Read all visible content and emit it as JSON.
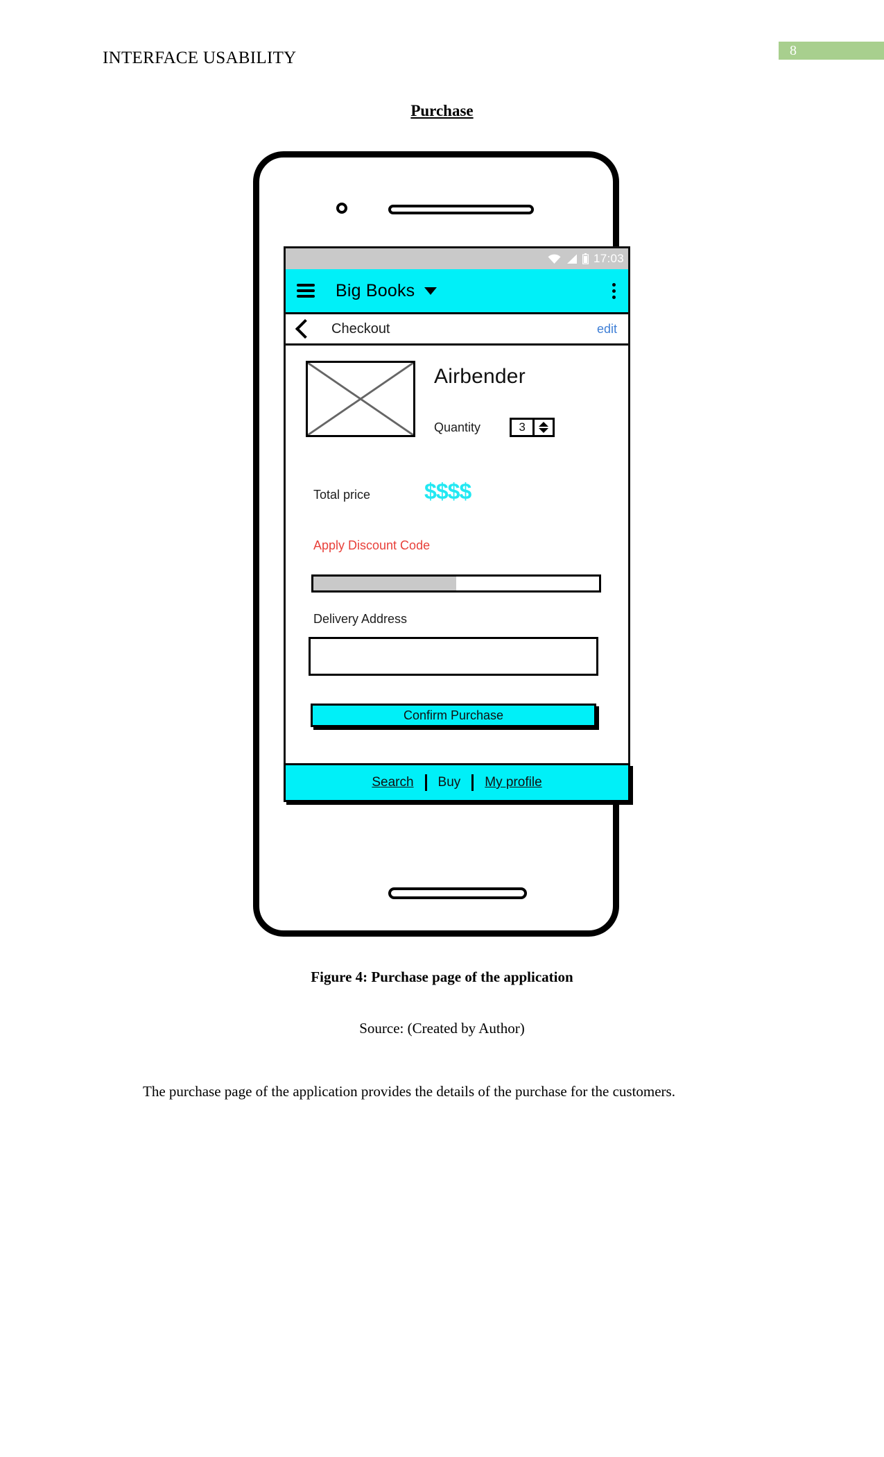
{
  "document": {
    "header_title": "INTERFACE USABILITY",
    "page_number": "8",
    "page_number_bg": "#a8cf8e",
    "section_title": "Purchase",
    "figure_caption": "Figure 4: Purchase page of the application",
    "figure_source": "Source: (Created by Author)",
    "body_paragraph": "The purchase page of the application provides the details of the purchase for the customers."
  },
  "mockup": {
    "status_bar": {
      "time": "17:03",
      "icons": [
        "wifi-icon",
        "signal-icon",
        "battery-icon"
      ],
      "bg": "#c9c9c9"
    },
    "app_bar": {
      "menu_icon": "hamburger-icon",
      "title": "Big Books",
      "dropdown_icon": "chevron-down-icon",
      "overflow_icon": "overflow-menu-icon",
      "bg": "#00f0f8"
    },
    "sub_bar": {
      "back_icon": "back-chevron-icon",
      "title": "Checkout",
      "edit_label": "edit",
      "edit_color": "#3f7fd6"
    },
    "product": {
      "image_placeholder": "image-placeholder-icon",
      "name": "Airbender",
      "quantity_label": "Quantity",
      "quantity_value": "3"
    },
    "price": {
      "label": "Total price",
      "value": "$$$$",
      "value_color": "#22e8f2"
    },
    "discount": {
      "label": "Apply Discount Code",
      "label_color": "#e8403a",
      "input_value": "",
      "fill_percent": 50
    },
    "address": {
      "label": "Delivery Address",
      "input_value": ""
    },
    "confirm": {
      "label": "Confirm Purchase",
      "bg": "#00f0f8"
    },
    "bottom_nav": {
      "bg": "#00f0f8",
      "items": [
        {
          "label": "Search",
          "underlined": true
        },
        {
          "label": "Buy",
          "underlined": false
        },
        {
          "label": "My profile",
          "underlined": true
        }
      ]
    }
  }
}
